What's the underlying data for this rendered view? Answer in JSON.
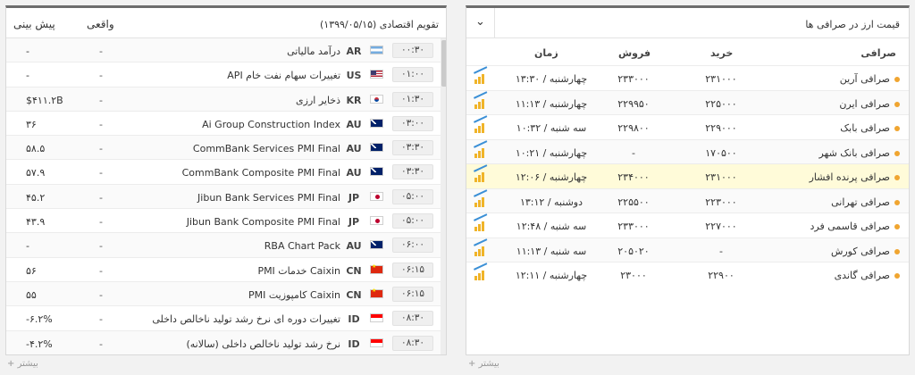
{
  "calendar": {
    "title": "تقویم اقتصادی (۱۳۹۹/۰۵/۱۵)",
    "col_actual": "واقعی",
    "col_forecast": "پیش بینی",
    "more_label": "بیشتر",
    "rows": [
      {
        "time": "۰۰:۳۰",
        "flag": "ar",
        "country": "AR",
        "event": "درآمد مالیاتی",
        "actual": "-",
        "forecast": "-"
      },
      {
        "time": "۰۱:۰۰",
        "flag": "us",
        "country": "US",
        "event": "تغییرات سهام نفت خام API",
        "actual": "-",
        "forecast": "-"
      },
      {
        "time": "۰۱:۳۰",
        "flag": "kr",
        "country": "KR",
        "event": "ذخایر ارزی",
        "actual": "-",
        "forecast": "$۴۱۱.۲B"
      },
      {
        "time": "۰۳:۰۰",
        "flag": "au",
        "country": "AU",
        "event": "Ai Group Construction Index",
        "actual": "-",
        "forecast": "۳۶"
      },
      {
        "time": "۰۳:۳۰",
        "flag": "au",
        "country": "AU",
        "event": "CommBank Services PMI Final",
        "actual": "-",
        "forecast": "۵۸.۵"
      },
      {
        "time": "۰۳:۳۰",
        "flag": "au",
        "country": "AU",
        "event": "CommBank Composite PMI Final",
        "actual": "-",
        "forecast": "۵۷.۹"
      },
      {
        "time": "۰۵:۰۰",
        "flag": "jp",
        "country": "JP",
        "event": "Jibun Bank Services PMI Final",
        "actual": "-",
        "forecast": "۴۵.۲"
      },
      {
        "time": "۰۵:۰۰",
        "flag": "jp",
        "country": "JP",
        "event": "Jibun Bank Composite PMI Final",
        "actual": "-",
        "forecast": "۴۳.۹"
      },
      {
        "time": "۰۶:۰۰",
        "flag": "au",
        "country": "AU",
        "event": "RBA Chart Pack",
        "actual": "-",
        "forecast": "-"
      },
      {
        "time": "۰۶:۱۵",
        "flag": "cn",
        "country": "CN",
        "event": "Caixin خدمات PMI",
        "actual": "-",
        "forecast": "۵۶"
      },
      {
        "time": "۰۶:۱۵",
        "flag": "cn",
        "country": "CN",
        "event": "Caixin کامپوزیت PMI",
        "actual": "-",
        "forecast": "۵۵"
      },
      {
        "time": "۰۸:۳۰",
        "flag": "id",
        "country": "ID",
        "event": "تغییرات دوره ای نرخ رشد تولید ناخالص داخلی",
        "actual": "-",
        "forecast": "-۶.۲%"
      },
      {
        "time": "۰۸:۳۰",
        "flag": "id",
        "country": "ID",
        "event": "نرخ رشد تولید ناخالص داخلی (سالانه)",
        "actual": "-",
        "forecast": "-۴.۲%"
      }
    ]
  },
  "exchange": {
    "title": "قیمت ارز در صرافی ها",
    "dropdown_icon": "chevron-down-icon",
    "col_exchange": "صرافی",
    "col_buy": "خرید",
    "col_sell": "فروش",
    "col_time": "زمان",
    "more_label": "بیشتر",
    "accent_dot": "#f0a530",
    "highlight_bg": "#fffbd9",
    "rows": [
      {
        "name": "صرافی آرین",
        "buy": "۲۳۱۰۰۰",
        "sell": "۲۳۳۰۰۰",
        "time": "چهارشنبه / ۱۳:۳۰",
        "highlight": false
      },
      {
        "name": "صرافی ایرن",
        "buy": "۲۲۵۰۰۰",
        "sell": "۲۲۹۹۵۰",
        "time": "چهارشنبه / ۱۱:۱۳",
        "highlight": false
      },
      {
        "name": "صرافی بابک",
        "buy": "۲۲۹۰۰۰",
        "sell": "۲۲۹۸۰۰",
        "time": "سه شنبه / ۱۰:۳۲",
        "highlight": false
      },
      {
        "name": "صرافی بانک شهر",
        "buy": "۱۷۰۵۰۰",
        "sell": "-",
        "time": "چهارشنبه / ۱۰:۲۱",
        "highlight": false
      },
      {
        "name": "صرافی پرنده افشار",
        "buy": "۲۳۱۰۰۰",
        "sell": "۲۳۴۰۰۰",
        "time": "چهارشنبه / ۱۲:۰۶",
        "highlight": true
      },
      {
        "name": "صرافی تهرانی",
        "buy": "۲۲۳۰۰۰",
        "sell": "۲۲۵۵۰۰",
        "time": "دوشنبه / ۱۳:۱۲",
        "highlight": false
      },
      {
        "name": "صرافی قاسمی فرد",
        "buy": "۲۲۷۰۰۰",
        "sell": "۲۳۳۰۰۰",
        "time": "سه شنبه / ۱۲:۴۸",
        "highlight": false
      },
      {
        "name": "صرافی کورش",
        "buy": "-",
        "sell": "۲۰۵۰۲۰",
        "time": "سه شنبه / ۱۱:۱۳",
        "highlight": false
      },
      {
        "name": "صرافی گاندی",
        "buy": "۲۲۹۰۰",
        "sell": "۲۳۰۰۰",
        "time": "چهارشنبه / ۱۲:۱۱",
        "highlight": false
      }
    ]
  }
}
